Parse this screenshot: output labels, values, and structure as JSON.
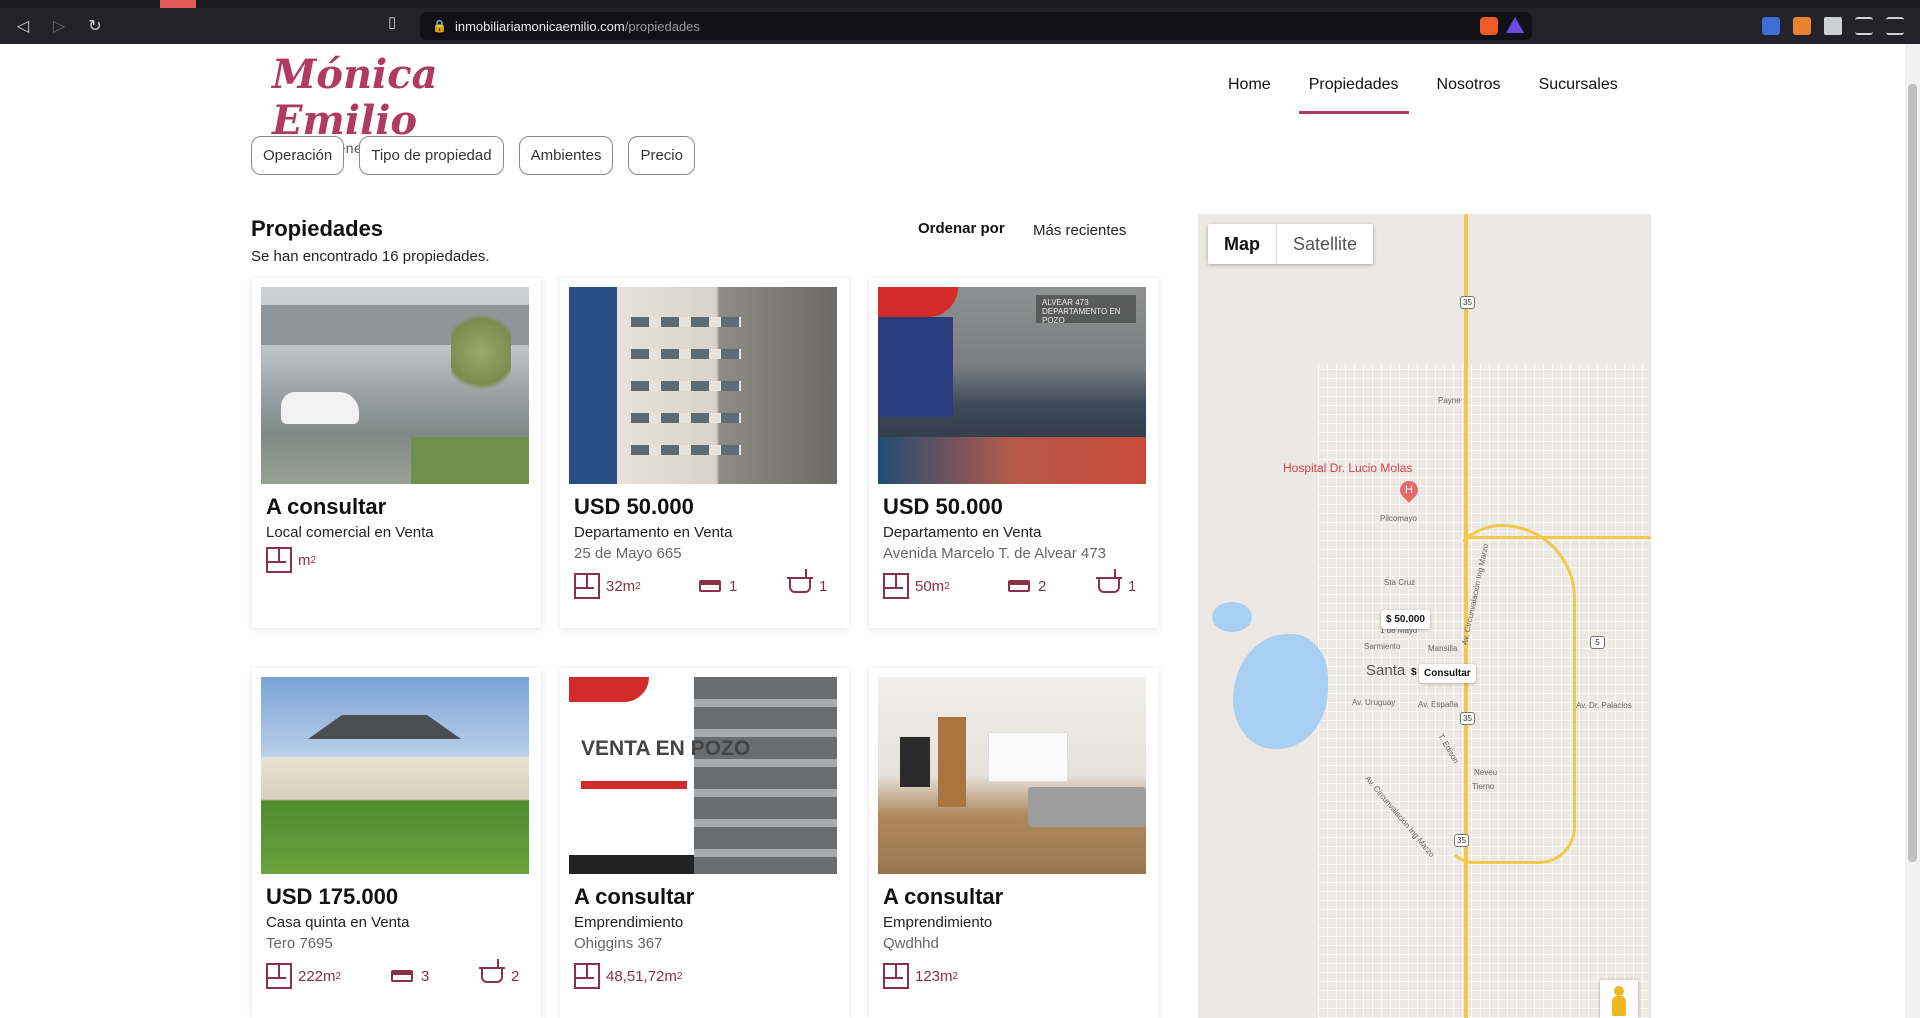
{
  "browser": {
    "url_host": "inmobiliariamonicaemilio.com",
    "url_path": "/propiedades"
  },
  "site": {
    "logo_title": "Mónica Emilio",
    "logo_subtitle": "Bienes Raíces",
    "nav": [
      "Home",
      "Propiedades",
      "Nosotros",
      "Sucursales"
    ],
    "nav_active": "Propiedades",
    "accent_color": "#b03a62"
  },
  "filters": [
    "Operación",
    "Tipo de propiedad",
    "Ambientes",
    "Precio"
  ],
  "listing": {
    "title": "Propiedades",
    "count_text": "Se han encontrado 16 propiedades.",
    "sort_label": "Ordenar por",
    "sort_value": "Más recientes"
  },
  "cards": [
    {
      "price": "A consultar",
      "type": "Local comercial en Venta",
      "address": "",
      "area": "m",
      "beds": "",
      "baths": ""
    },
    {
      "price": "USD 50.000",
      "type": "Departamento en Venta",
      "address": "25 de Mayo 665",
      "area": "32m",
      "beds": "1",
      "baths": "1"
    },
    {
      "price": "USD 50.000",
      "type": "Departamento en Venta",
      "address": "Avenida Marcelo T. de Alvear 473",
      "area": "50m",
      "beds": "2",
      "baths": "1",
      "image_banner": "ALVEAR 473 DEPARTAMENTO EN POZO"
    },
    {
      "price": "USD 175.000",
      "type": "Casa quinta en Venta",
      "address": "Tero 7695",
      "area": "222m",
      "beds": "3",
      "baths": "2"
    },
    {
      "price": "A consultar",
      "type": "Emprendimiento",
      "address": "Ohiggins 367",
      "area": "48,51,72m",
      "beds": "",
      "baths": "",
      "image_text": "VENTA EN POZO"
    },
    {
      "price": "A consultar",
      "type": "Emprendimiento",
      "address": "Qwdhhd",
      "area": "123m",
      "beds": "",
      "baths": ""
    }
  ],
  "map": {
    "toggle_map": "Map",
    "toggle_satellite": "Satellite",
    "poi_hospital": "Hospital Dr. Lucio Molas",
    "marker_price": "$ 50.000",
    "marker_consult": "Consultar",
    "marker_dollar": "$",
    "city_partial": "Santa",
    "route_35": "35",
    "route_5": "5",
    "streets": {
      "payne": "Payne",
      "pilcomayo": "Pilcomayo",
      "sta_cruz": "Sta Cruz",
      "mayo": "1 de Mayo",
      "mansilla": "Mansilla",
      "sarmiento": "Sarmiento",
      "uruguay": "Av. Uruguay",
      "espana": "Av. España",
      "palacios": "Av. Dr. Palacios",
      "neveu": "Neveu",
      "tierno": "Tierno",
      "edison": "T. Edison",
      "circunvalacion": "Av. Circunvalación Ing Marzo",
      "circunvalacion2": "Av. Circunvalación Ing Marzo"
    }
  }
}
